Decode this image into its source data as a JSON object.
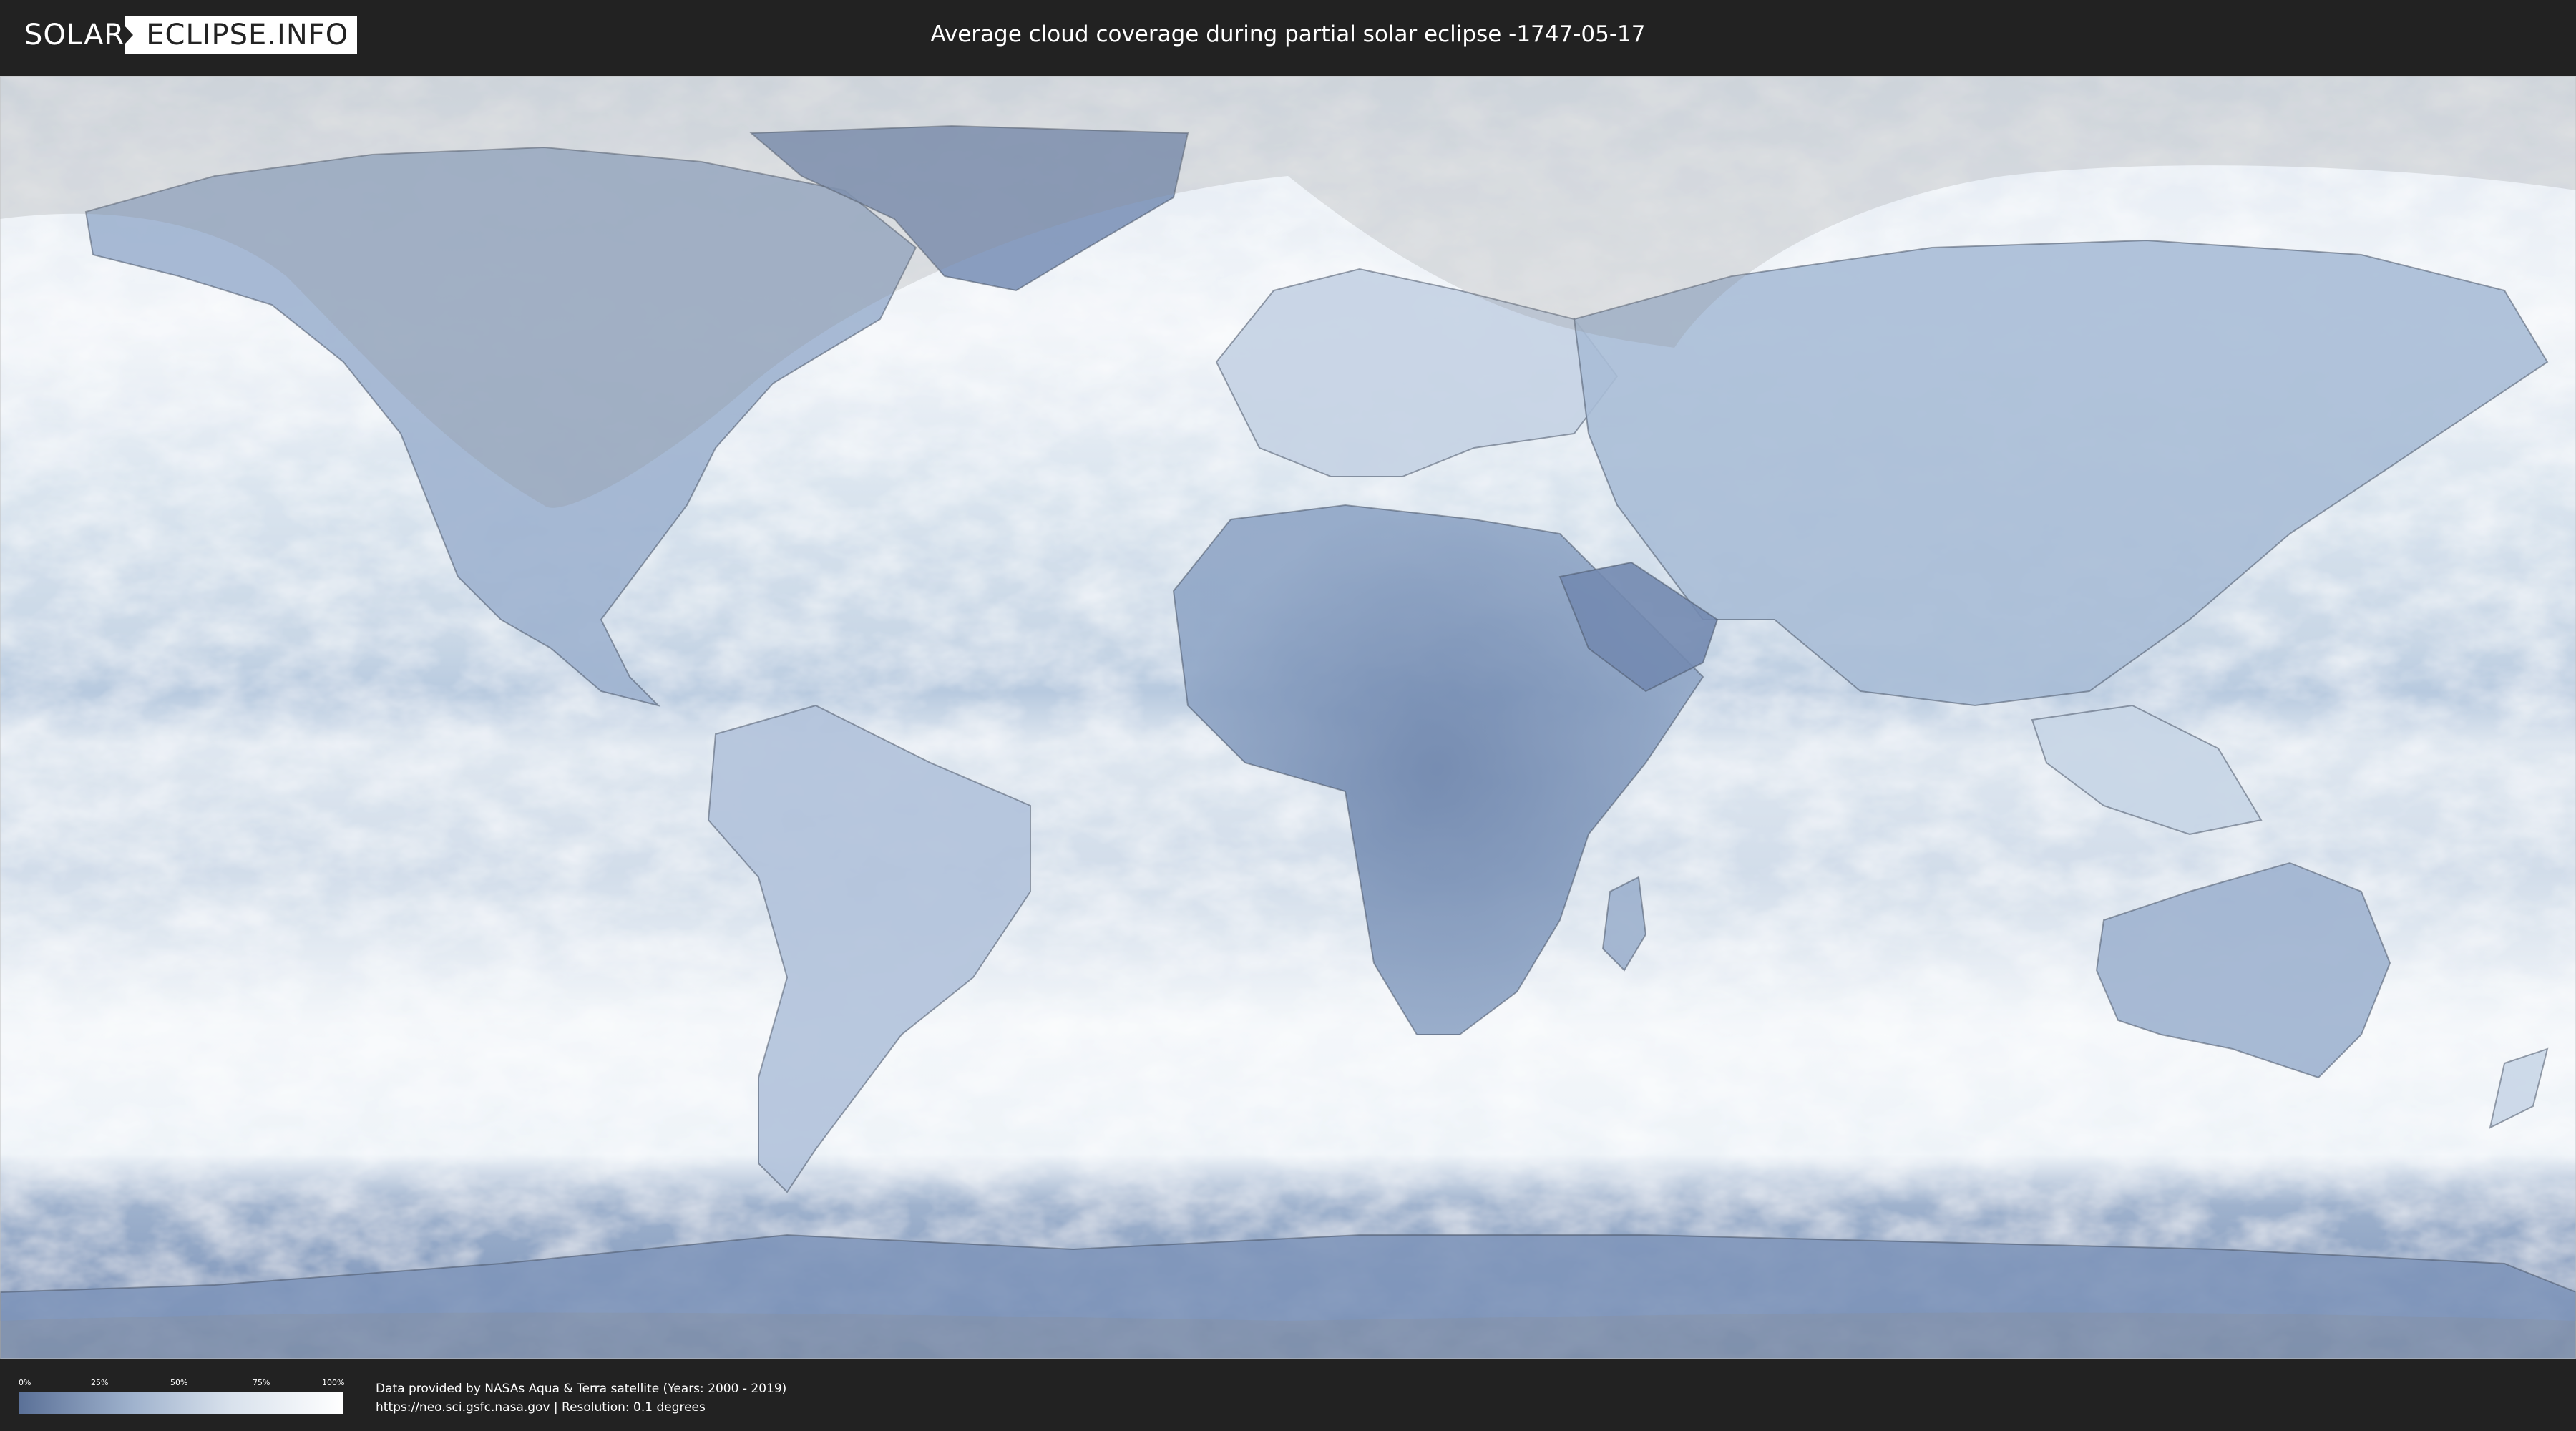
{
  "header": {
    "logo_left": "SOLAR",
    "logo_right": "ECLIPSE.INFO",
    "title": "Average cloud coverage during partial solar eclipse -1747-05-17"
  },
  "map": {
    "projection": "equirectangular",
    "colors": {
      "clear_sky": "#5a7097",
      "full_cloud": "#ffffff",
      "eclipse_shadow_overlay": "#8f8f8f",
      "borders": "#4a5668"
    }
  },
  "legend": {
    "ticks": [
      "0%",
      "25%",
      "50%",
      "75%",
      "100%"
    ],
    "tick_values": [
      0,
      25,
      50,
      75,
      100
    ],
    "gradient": [
      "#5a7097",
      "#9fb2cd",
      "#d8e1ec",
      "#ffffff"
    ]
  },
  "footer": {
    "credit_line1": "Data provided by NASAs Aqua & Terra satellite (Years: 2000 - 2019)",
    "credit_line2": "https://neo.sci.gsfc.nasa.gov | Resolution: 0.1 degrees"
  }
}
